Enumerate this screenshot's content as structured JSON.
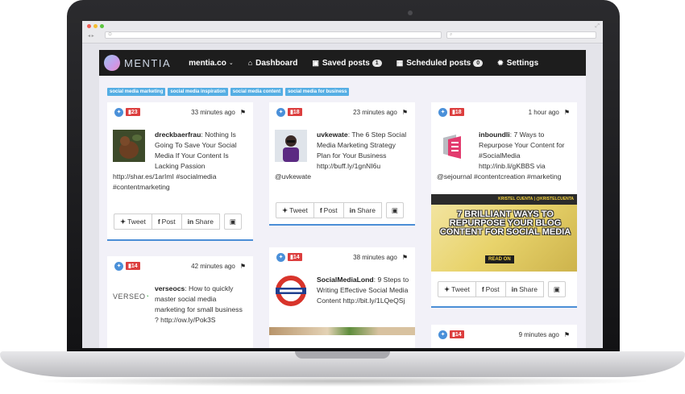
{
  "nav": {
    "brand": "MENTIA",
    "account": "mentia.co",
    "items": [
      {
        "label": "Dashboard",
        "icon": "home-icon"
      },
      {
        "label": "Saved posts",
        "icon": "save-icon",
        "count": "1"
      },
      {
        "label": "Scheduled posts",
        "icon": "calendar-icon",
        "count": "0"
      },
      {
        "label": "Settings",
        "icon": "gear-icon"
      }
    ]
  },
  "tags": [
    "social media marketing",
    "social media inspiration",
    "social media content",
    "social media for business"
  ],
  "actions": {
    "tweet": "Tweet",
    "post": "Post",
    "share": "Share"
  },
  "posts": [
    {
      "score": "23",
      "time": "33 minutes ago",
      "author": "dreckbaerfrau",
      "lead": ": Nothing Is Going To Save Your Social Media If Your Content Is Lacking Passion",
      "rest": "http://shar.es/1arImI #socialmedia #contentmarketing"
    },
    {
      "score": "18",
      "time": "23 minutes ago",
      "author": "uvkewate",
      "lead": ": The 6 Step Social Media Marketing Strategy Plan for Your Business http://buff.ly/1gnNI6u",
      "rest": "@uvkewate"
    },
    {
      "score": "18",
      "time": "1 hour ago",
      "author": "inboundli",
      "lead": ": 7 Ways to Repurpose Your Content for #SocialMedia http://inb.li/gKBBS via",
      "rest": "@sejournal #contentcreation #marketing",
      "promo_title": "7 BRILLIANT WAYS TO REPURPOSE YOUR BLOG CONTENT FOR SOCIAL MEDIA",
      "promo_strip": "KRISTEL CUENTA | @KRISTELCUENTA",
      "promo_read": "READ ON"
    },
    {
      "score": "14",
      "time": "42 minutes ago",
      "author": "verseocs",
      "lead": ": How to quickly master social media marketing for small business ? http://ow.ly/Pok3S",
      "rest": "",
      "logo": "VERSEO"
    },
    {
      "score": "14",
      "time": "38 minutes ago",
      "author": "SocialMediaLond",
      "lead": ": 9 Steps to Writing Effective Social Media Content http://bit.ly/1LQeQSj",
      "rest": ""
    },
    {
      "score": "14",
      "time": "9 minutes ago",
      "author": "",
      "lead": "",
      "rest": ""
    }
  ],
  "colors": {
    "twitter": "#4a90d9",
    "score": "#dc3e3e",
    "tag": "#55aee4",
    "nav": "#1d1d1d",
    "accent": "#4b8ed6"
  }
}
